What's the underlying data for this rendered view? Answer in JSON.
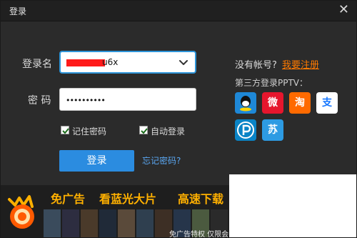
{
  "window": {
    "title": "登录",
    "close_glyph": "✕"
  },
  "form": {
    "username_label": "登录名",
    "username_value_visible_suffix": "u6x",
    "password_label": "密 码",
    "password_mask": "••••••••••",
    "remember_password_label": "记住密码",
    "auto_login_label": "自动登录",
    "login_button": "登录",
    "forgot_password": "忘记密码?"
  },
  "account": {
    "no_account_text": "没有帐号?",
    "register_link": "我要注册",
    "third_party_title": "第三方登录PPTV："
  },
  "social_icons": [
    {
      "name": "qq-icon",
      "glyph": "Q",
      "color": "#1e88d7"
    },
    {
      "name": "weibo-icon",
      "glyph": "微",
      "color": "#e6162d"
    },
    {
      "name": "taobao-icon",
      "glyph": "淘",
      "color": "#ff6a00"
    },
    {
      "name": "alipay-icon",
      "glyph": "支",
      "color": "#ffffff"
    },
    {
      "name": "pptv-icon",
      "glyph": "P",
      "color": "#0a84c6"
    },
    {
      "name": "suning-icon",
      "glyph": "苏",
      "color": "#2d9be3"
    }
  ],
  "banner": {
    "text_1": "免广告",
    "text_2": "看蓝光大片",
    "text_3": "高速下载",
    "bottom_caption": "免广告特权 仅限会"
  },
  "colors": {
    "accent_blue": "#2b8ce0",
    "register_orange": "#ff7a00",
    "dialog_bg": "#2b2b2b"
  }
}
